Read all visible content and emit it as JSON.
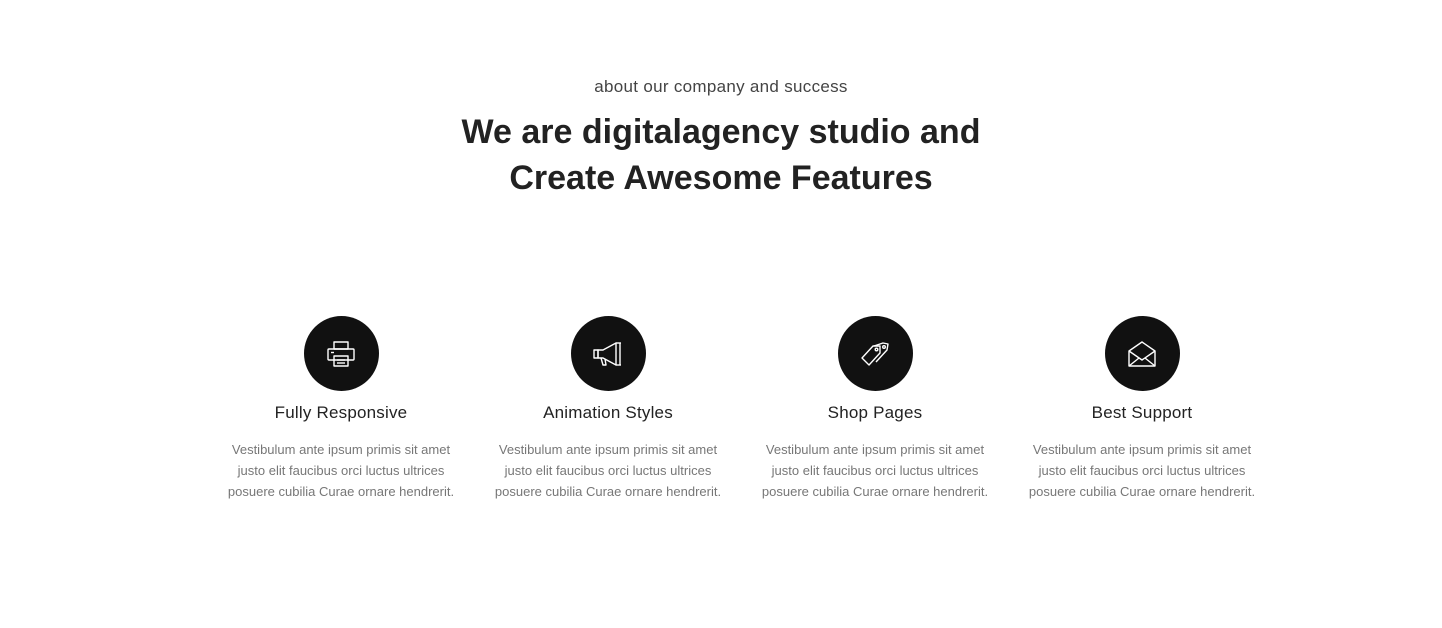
{
  "header": {
    "eyebrow": "about our company and success",
    "title_line1": "We are digitalagency studio and",
    "title_line2": "Create Awesome Features"
  },
  "features": [
    {
      "icon": "printer-icon",
      "title": "Fully Responsive",
      "text": "Vestibulum ante ipsum primis sit amet justo elit faucibus orci luctus ultrices posuere cubilia Curae ornare hendrerit."
    },
    {
      "icon": "megaphone-icon",
      "title": "Animation Styles",
      "text": "Vestibulum ante ipsum primis sit amet justo elit faucibus orci luctus ultrices posuere cubilia Curae ornare hendrerit."
    },
    {
      "icon": "price-tags-icon",
      "title": "Shop Pages",
      "text": "Vestibulum ante ipsum primis sit amet justo elit faucibus orci luctus ultrices posuere cubilia Curae ornare hendrerit."
    },
    {
      "icon": "envelope-icon",
      "title": "Best Support",
      "text": "Vestibulum ante ipsum primis sit amet justo elit faucibus orci luctus ultrices posuere cubilia Curae ornare hendrerit."
    }
  ],
  "colors": {
    "icon_circle": "#111111",
    "heading": "#222222",
    "body_text": "#777777"
  }
}
